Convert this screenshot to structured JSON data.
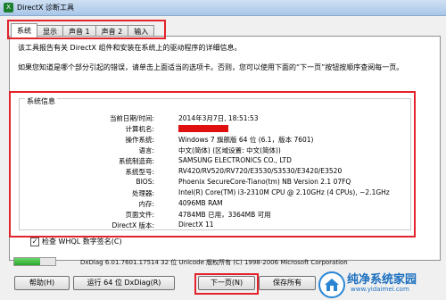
{
  "window": {
    "title": "DirectX 诊断工具",
    "app_icon": "X"
  },
  "tabs": [
    {
      "label": "系统"
    },
    {
      "label": "显示"
    },
    {
      "label": "声音 1"
    },
    {
      "label": "声音 2"
    },
    {
      "label": "输入"
    }
  ],
  "intro": {
    "line1": "该工具报告有关 DirectX 组件和安装在系统上的驱动程序的详细信息。",
    "line2": "如果您知道是哪个部分引起的错误，请单击上面适当的选项卡。否则，您可以使用下面的“下一页”按钮按顺序查阅每一页。"
  },
  "system_info": {
    "title": "系统信息",
    "rows": [
      {
        "label": "当前日期/时间:",
        "value": "2014年3月7日, 18:51:53"
      },
      {
        "label": "计算机名:",
        "value": ""
      },
      {
        "label": "操作系统:",
        "value": "Windows 7 旗舰版 64 位 (6.1，版本 7601)"
      },
      {
        "label": "语言:",
        "value": "中文(简体) (区域设置: 中文(简体))"
      },
      {
        "label": "系统制造商:",
        "value": "SAMSUNG ELECTRONICS CO., LTD"
      },
      {
        "label": "系统型号:",
        "value": "RV420/RV520/RV720/E3530/S3530/E3420/E3520"
      },
      {
        "label": "BIOS:",
        "value": "Phoenix SecureCore-Tiano(tm) NB Version 2.1 07FQ"
      },
      {
        "label": "处理器:",
        "value": "Intel(R) Core(TM) i3-2310M CPU @ 2.10GHz (4 CPUs), ~2.1GHz"
      },
      {
        "label": "内存:",
        "value": "4096MB RAM"
      },
      {
        "label": "页面文件:",
        "value": "4784MB 已用，3364MB 可用"
      },
      {
        "label": "DirectX 版本:",
        "value": "DirectX 11"
      }
    ]
  },
  "whql_check": {
    "label": "检查 WHQL 数字签名(C)",
    "checked": true
  },
  "status": {
    "progress": 0.62,
    "text": "DxDiag 6.01.7601.17514 32 位 Unicode 版权所有 (C) 1998-2006 Microsoft Corporation"
  },
  "buttons": {
    "help": "帮助(H)",
    "run64": "运行 64 位 DxDiag(R)",
    "next": "下一页(N)",
    "save": "保存所有"
  },
  "watermark": {
    "name": "纯净系统家园",
    "url": "www.yidaimei.com"
  },
  "colors": {
    "annotation": "#e3232b",
    "redaction": "#e01010"
  }
}
